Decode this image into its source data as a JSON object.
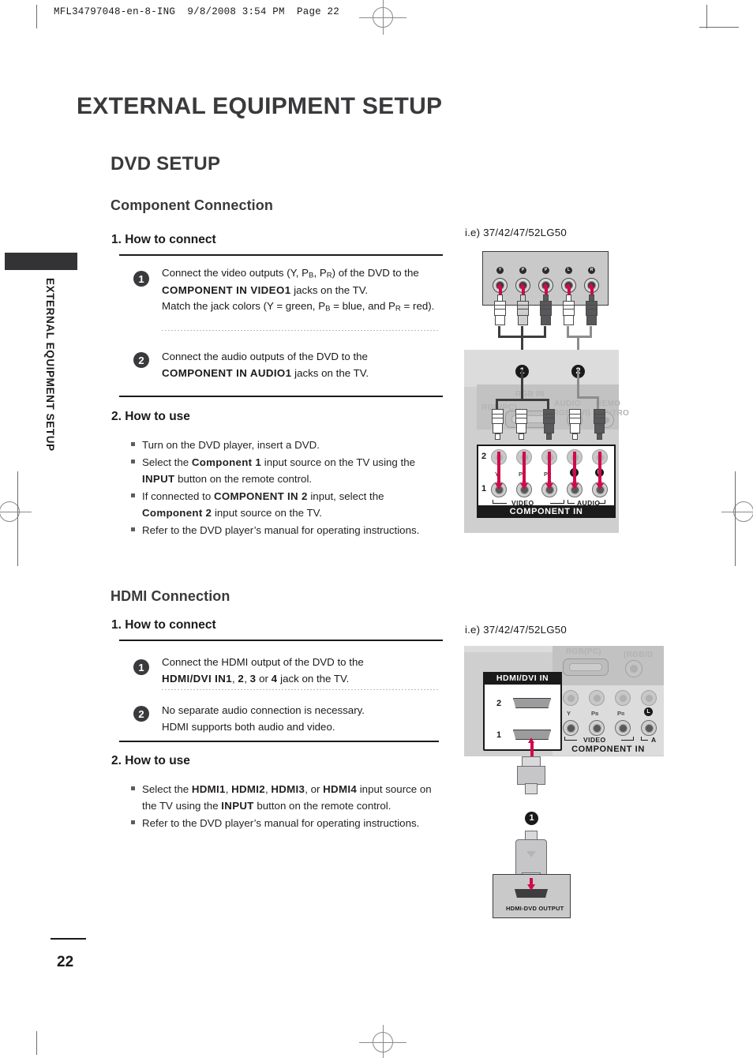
{
  "film_header": "MFL34797048-en-8-ING  9/8/2008 3:54 PM  Page 22",
  "sidebar": {
    "vertical_label": "EXTERNAL EQUIPMENT SETUP"
  },
  "page_number": "22",
  "headings": {
    "chapter": "EXTERNAL EQUIPMENT SETUP",
    "section": "DVD SETUP",
    "component_connection": "Component Connection",
    "hdmi_connection": "HDMI Connection",
    "how_to_connect": "1. How to connect",
    "how_to_use": "2. How to use",
    "hdmi_how_to_connect": "1. How to connect",
    "hdmi_how_to_use": "2. How to use"
  },
  "component": {
    "step1": {
      "num": "1",
      "line1_a": "Connect the video outputs (Y, P",
      "line1_sub1": "B",
      "line1_b": ", P",
      "line1_sub2": "R",
      "line1_c": ")  of the DVD to the",
      "line2_bold": "COMPONENT IN VIDEO1",
      "line2_rest": " jacks on the TV.",
      "line3_a": "Match the jack colors (Y = green, P",
      "line3_sub1": "B",
      "line3_b": " = blue, and P",
      "line3_sub2": "R",
      "line3_c": " = red)."
    },
    "step2": {
      "num": "2",
      "line1": "Connect the audio outputs of the DVD to the",
      "line2_bold": "COMPONENT IN AUDIO1",
      "line2_rest": " jacks on the TV."
    },
    "use_bullets": [
      {
        "parts": [
          {
            "t": "Turn on the DVD player, insert a DVD.",
            "b": false
          }
        ]
      },
      {
        "parts": [
          {
            "t": "Select the ",
            "b": false
          },
          {
            "t": "Component 1",
            "b": true
          },
          {
            "t": " input source on the TV using the ",
            "b": false
          },
          {
            "t": "INPUT",
            "b": true
          },
          {
            "t": " button on the remote control.",
            "b": false
          }
        ]
      },
      {
        "parts": [
          {
            "t": "If connected to ",
            "b": false
          },
          {
            "t": "COMPONENT IN 2",
            "b": true
          },
          {
            "t": " input, select the ",
            "b": false
          },
          {
            "t": "Component 2",
            "b": true
          },
          {
            "t": " input source on the TV.",
            "b": false
          }
        ]
      },
      {
        "parts": [
          {
            "t": "Refer to the DVD player’s manual for operating instructions.",
            "b": false
          }
        ]
      }
    ]
  },
  "hdmi": {
    "step1": {
      "num": "1",
      "line1": "Connect the HDMI output of the DVD to the",
      "line2_parts": [
        {
          "t": "HDMI/DVI IN1",
          "b": true
        },
        {
          "t": ", ",
          "b": false
        },
        {
          "t": "2",
          "b": true
        },
        {
          "t": ", ",
          "b": false
        },
        {
          "t": "3",
          "b": true
        },
        {
          "t": " or ",
          "b": false
        },
        {
          "t": "4",
          "b": true
        },
        {
          "t": " jack on the TV.",
          "b": false
        }
      ]
    },
    "step2": {
      "num": "2",
      "line1": "No separate audio connection is necessary.",
      "line2": "HDMI supports both audio and video."
    },
    "use_bullets": [
      {
        "parts": [
          {
            "t": "Select the ",
            "b": false
          },
          {
            "t": "HDMI1",
            "b": true
          },
          {
            "t": ", ",
            "b": false
          },
          {
            "t": "HDMI2",
            "b": true
          },
          {
            "t": ", ",
            "b": false
          },
          {
            "t": "HDMI3",
            "b": true
          },
          {
            "t": ", or ",
            "b": false
          },
          {
            "t": "HDMI4",
            "b": true
          },
          {
            "t": " input source on the TV using the ",
            "b": false
          },
          {
            "t": "INPUT",
            "b": true
          },
          {
            "t": " button on the remote control.",
            "b": false
          }
        ]
      },
      {
        "parts": [
          {
            "t": "Refer to the DVD player’s manual for operating instructions.",
            "b": false
          }
        ]
      }
    ]
  },
  "figures": {
    "fig1_label": "i.e) 37/42/47/52LG50",
    "fig2_label": "i.e) 37/42/47/52LG50",
    "dvd_jack_badges": [
      "Y",
      "P",
      "P",
      "L",
      "R"
    ],
    "tv_panel": {
      "rgb_in": "RGB IN",
      "rgb_pc": "RGB(PC)",
      "audio_rgb_dvi_1": "AUDIO",
      "audio_rgb_dvi_2": "(RGB/DVI)",
      "remote_1": "REMO",
      "remote_2": "CONTRO",
      "component_in": "COMPONENT IN",
      "video_group": "VIDEO",
      "audio_group": "AUDIO",
      "row_top": "2",
      "row_bottom": "1",
      "jack_y": "Y",
      "jack_pb_main": "P",
      "jack_pb_sub": "B",
      "jack_pr_main": "P",
      "jack_pr_sub": "R",
      "jack_l": "L",
      "jack_r": "R"
    },
    "callout_1": "1",
    "callout_2": "2",
    "hdmi_panel": {
      "title": "HDMI/DVI IN",
      "port_2": "2",
      "port_1": "1",
      "rgb_pc_ghost": "RGB(PC)",
      "rgb_dvi_ghost": "(RGB/D",
      "component_in": "COMPONENT IN",
      "video_group": "VIDEO",
      "audio_group": "A",
      "row_top": "2",
      "row_bottom": "1",
      "jack_y": "Y",
      "jack_pb_main": "P",
      "jack_pb_sub": "B",
      "jack_pr_main": "P",
      "jack_pr_sub": "R",
      "jack_l": "L"
    },
    "hdmi_callout": "1",
    "dvd_output_label": "HDMI-DVD OUTPUT"
  },
  "colors": {
    "accent_magenta": "#d10a4a",
    "ink": "#1a1a1a",
    "heading_grey": "#3a3a3c",
    "panel_grey": "#cfcfcf"
  }
}
